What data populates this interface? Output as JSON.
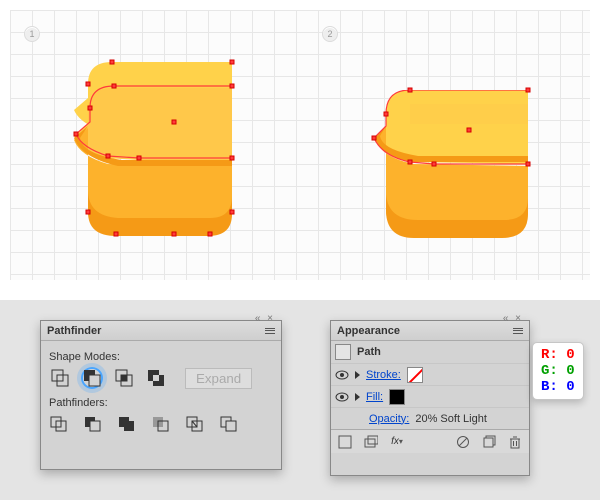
{
  "steps": {
    "one": "1",
    "two": "2"
  },
  "pathfinder": {
    "title": "Pathfinder",
    "shape_modes_label": "Shape Modes:",
    "expand_label": "Expand",
    "pathfinders_label": "Pathfinders:"
  },
  "appearance": {
    "title": "Appearance",
    "item_label": "Path",
    "stroke_label": "Stroke:",
    "fill_label": "Fill:",
    "opacity_label": "Opacity:",
    "opacity_value": "20% Soft Light",
    "fx_label": "fx"
  },
  "rgb": {
    "r": "R: 0",
    "g": "G: 0",
    "b": "B: 0"
  }
}
